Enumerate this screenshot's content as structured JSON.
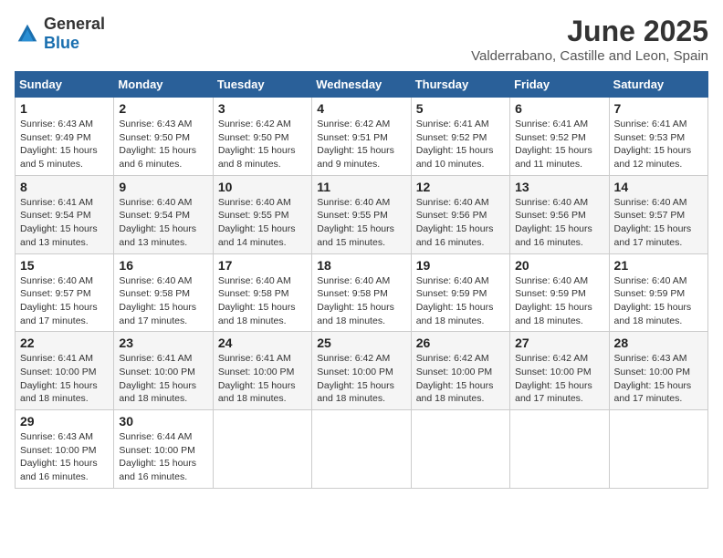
{
  "logo": {
    "general": "General",
    "blue": "Blue"
  },
  "header": {
    "title": "June 2025",
    "subtitle": "Valderrabano, Castille and Leon, Spain"
  },
  "weekdays": [
    "Sunday",
    "Monday",
    "Tuesday",
    "Wednesday",
    "Thursday",
    "Friday",
    "Saturday"
  ],
  "weeks": [
    [
      {
        "day": "1",
        "sunrise": "6:43 AM",
        "sunset": "9:49 PM",
        "daylight": "15 hours and 5 minutes."
      },
      {
        "day": "2",
        "sunrise": "6:43 AM",
        "sunset": "9:50 PM",
        "daylight": "15 hours and 6 minutes."
      },
      {
        "day": "3",
        "sunrise": "6:42 AM",
        "sunset": "9:50 PM",
        "daylight": "15 hours and 8 minutes."
      },
      {
        "day": "4",
        "sunrise": "6:42 AM",
        "sunset": "9:51 PM",
        "daylight": "15 hours and 9 minutes."
      },
      {
        "day": "5",
        "sunrise": "6:41 AM",
        "sunset": "9:52 PM",
        "daylight": "15 hours and 10 minutes."
      },
      {
        "day": "6",
        "sunrise": "6:41 AM",
        "sunset": "9:52 PM",
        "daylight": "15 hours and 11 minutes."
      },
      {
        "day": "7",
        "sunrise": "6:41 AM",
        "sunset": "9:53 PM",
        "daylight": "15 hours and 12 minutes."
      }
    ],
    [
      {
        "day": "8",
        "sunrise": "6:41 AM",
        "sunset": "9:54 PM",
        "daylight": "15 hours and 13 minutes."
      },
      {
        "day": "9",
        "sunrise": "6:40 AM",
        "sunset": "9:54 PM",
        "daylight": "15 hours and 13 minutes."
      },
      {
        "day": "10",
        "sunrise": "6:40 AM",
        "sunset": "9:55 PM",
        "daylight": "15 hours and 14 minutes."
      },
      {
        "day": "11",
        "sunrise": "6:40 AM",
        "sunset": "9:55 PM",
        "daylight": "15 hours and 15 minutes."
      },
      {
        "day": "12",
        "sunrise": "6:40 AM",
        "sunset": "9:56 PM",
        "daylight": "15 hours and 16 minutes."
      },
      {
        "day": "13",
        "sunrise": "6:40 AM",
        "sunset": "9:56 PM",
        "daylight": "15 hours and 16 minutes."
      },
      {
        "day": "14",
        "sunrise": "6:40 AM",
        "sunset": "9:57 PM",
        "daylight": "15 hours and 17 minutes."
      }
    ],
    [
      {
        "day": "15",
        "sunrise": "6:40 AM",
        "sunset": "9:57 PM",
        "daylight": "15 hours and 17 minutes."
      },
      {
        "day": "16",
        "sunrise": "6:40 AM",
        "sunset": "9:58 PM",
        "daylight": "15 hours and 17 minutes."
      },
      {
        "day": "17",
        "sunrise": "6:40 AM",
        "sunset": "9:58 PM",
        "daylight": "15 hours and 18 minutes."
      },
      {
        "day": "18",
        "sunrise": "6:40 AM",
        "sunset": "9:58 PM",
        "daylight": "15 hours and 18 minutes."
      },
      {
        "day": "19",
        "sunrise": "6:40 AM",
        "sunset": "9:59 PM",
        "daylight": "15 hours and 18 minutes."
      },
      {
        "day": "20",
        "sunrise": "6:40 AM",
        "sunset": "9:59 PM",
        "daylight": "15 hours and 18 minutes."
      },
      {
        "day": "21",
        "sunrise": "6:40 AM",
        "sunset": "9:59 PM",
        "daylight": "15 hours and 18 minutes."
      }
    ],
    [
      {
        "day": "22",
        "sunrise": "6:41 AM",
        "sunset": "10:00 PM",
        "daylight": "15 hours and 18 minutes."
      },
      {
        "day": "23",
        "sunrise": "6:41 AM",
        "sunset": "10:00 PM",
        "daylight": "15 hours and 18 minutes."
      },
      {
        "day": "24",
        "sunrise": "6:41 AM",
        "sunset": "10:00 PM",
        "daylight": "15 hours and 18 minutes."
      },
      {
        "day": "25",
        "sunrise": "6:42 AM",
        "sunset": "10:00 PM",
        "daylight": "15 hours and 18 minutes."
      },
      {
        "day": "26",
        "sunrise": "6:42 AM",
        "sunset": "10:00 PM",
        "daylight": "15 hours and 18 minutes."
      },
      {
        "day": "27",
        "sunrise": "6:42 AM",
        "sunset": "10:00 PM",
        "daylight": "15 hours and 17 minutes."
      },
      {
        "day": "28",
        "sunrise": "6:43 AM",
        "sunset": "10:00 PM",
        "daylight": "15 hours and 17 minutes."
      }
    ],
    [
      {
        "day": "29",
        "sunrise": "6:43 AM",
        "sunset": "10:00 PM",
        "daylight": "15 hours and 16 minutes."
      },
      {
        "day": "30",
        "sunrise": "6:44 AM",
        "sunset": "10:00 PM",
        "daylight": "15 hours and 16 minutes."
      },
      null,
      null,
      null,
      null,
      null
    ]
  ],
  "labels": {
    "sunrise": "Sunrise:",
    "sunset": "Sunset:",
    "daylight": "Daylight:"
  }
}
